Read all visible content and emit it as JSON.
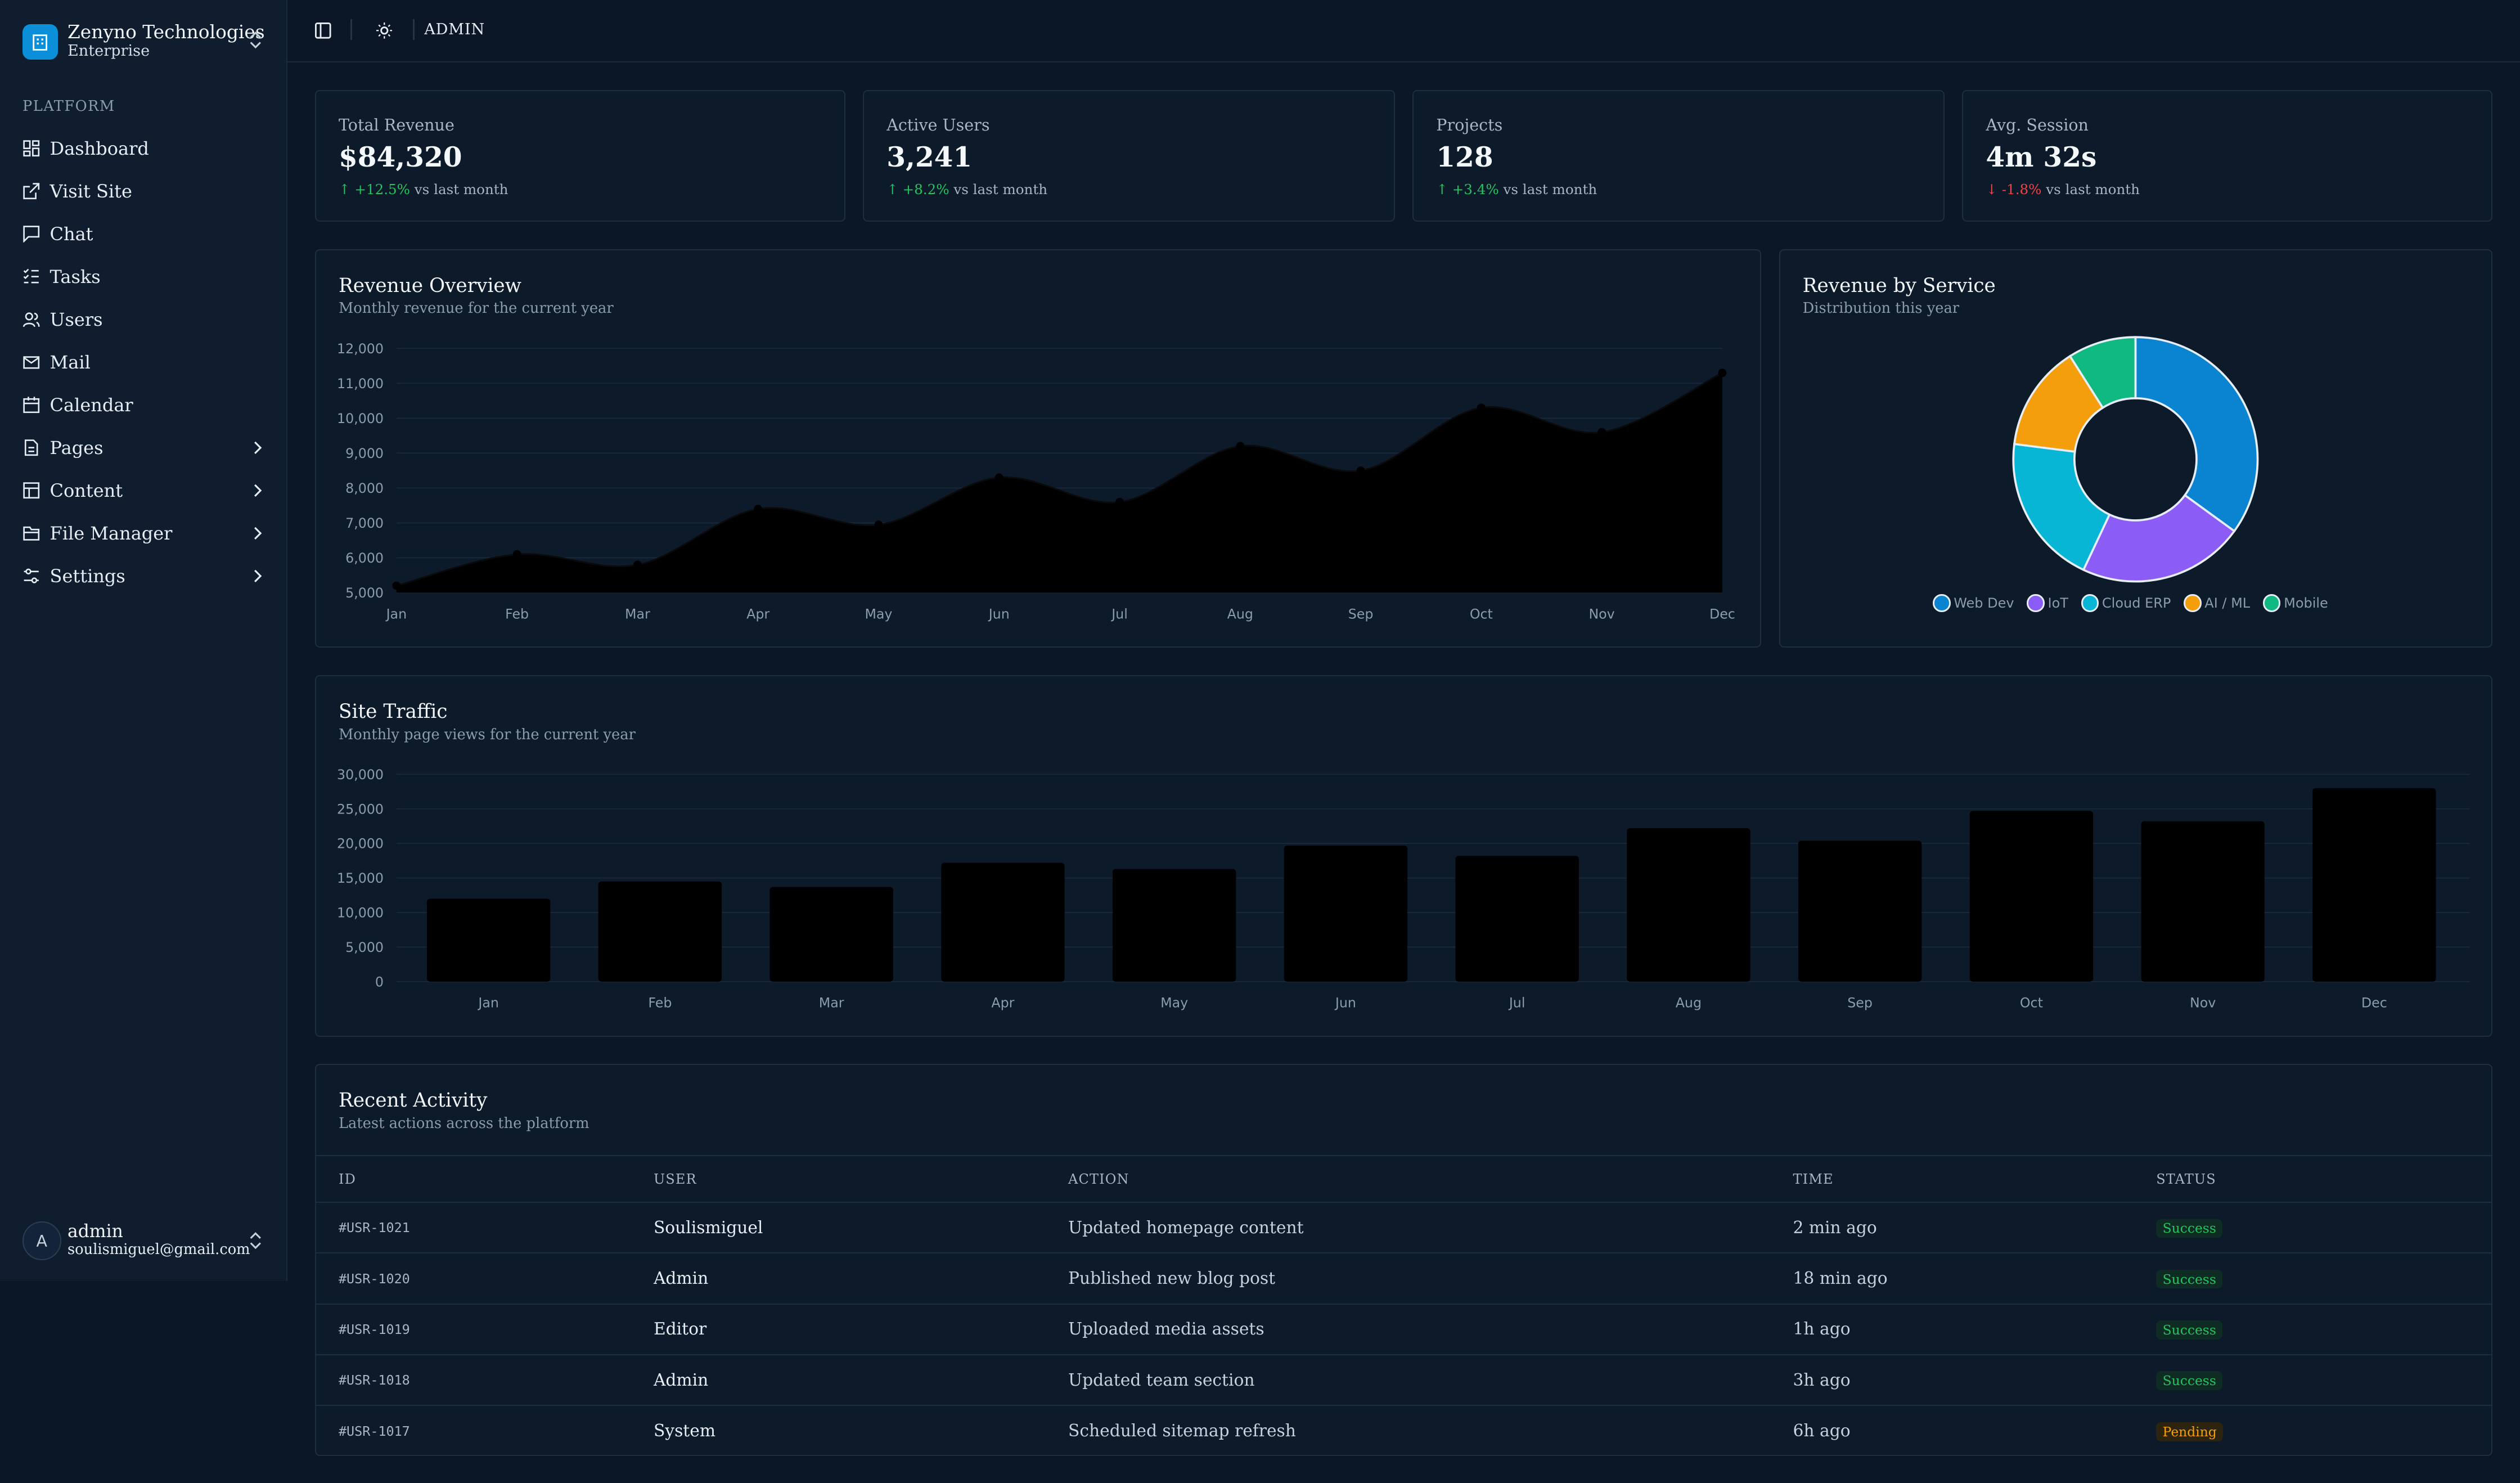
{
  "brand": {
    "name": "Zenyno Technologies",
    "plan": "Enterprise"
  },
  "sidebar": {
    "section_label": "PLATFORM",
    "items": [
      {
        "label": "Dashboard",
        "icon": "dashboard-icon",
        "has_submenu": false
      },
      {
        "label": "Visit Site",
        "icon": "external-link-icon",
        "has_submenu": false
      },
      {
        "label": "Chat",
        "icon": "chat-icon",
        "has_submenu": false
      },
      {
        "label": "Tasks",
        "icon": "tasks-icon",
        "has_submenu": false
      },
      {
        "label": "Users",
        "icon": "users-icon",
        "has_submenu": false
      },
      {
        "label": "Mail",
        "icon": "mail-icon",
        "has_submenu": false
      },
      {
        "label": "Calendar",
        "icon": "calendar-icon",
        "has_submenu": false
      },
      {
        "label": "Pages",
        "icon": "page-icon",
        "has_submenu": true
      },
      {
        "label": "Content",
        "icon": "layout-icon",
        "has_submenu": true
      },
      {
        "label": "File Manager",
        "icon": "folder-icon",
        "has_submenu": true
      },
      {
        "label": "Settings",
        "icon": "sliders-icon",
        "has_submenu": true
      }
    ],
    "user": {
      "initial": "A",
      "name": "admin",
      "email": "soulismiguel@gmail.com"
    }
  },
  "topbar": {
    "breadcrumb": "ADMIN"
  },
  "stats": [
    {
      "label": "Total Revenue",
      "value": "$84,320",
      "change": "+12.5%",
      "direction": "up",
      "suffix": "vs last month"
    },
    {
      "label": "Active Users",
      "value": "3,241",
      "change": "+8.2%",
      "direction": "up",
      "suffix": "vs last month"
    },
    {
      "label": "Projects",
      "value": "128",
      "change": "+3.4%",
      "direction": "up",
      "suffix": "vs last month"
    },
    {
      "label": "Avg. Session",
      "value": "4m 32s",
      "change": "-1.8%",
      "direction": "down",
      "suffix": "vs last month"
    }
  ],
  "revenue_card": {
    "title": "Revenue Overview",
    "subtitle": "Monthly revenue for the current year"
  },
  "service_card": {
    "title": "Revenue by Service",
    "subtitle": "Distribution this year"
  },
  "traffic_card": {
    "title": "Site Traffic",
    "subtitle": "Monthly page views for the current year"
  },
  "activity": {
    "title": "Recent Activity",
    "subtitle": "Latest actions across the platform",
    "columns": [
      "ID",
      "USER",
      "ACTION",
      "TIME",
      "STATUS"
    ],
    "rows": [
      {
        "id": "#USR-1021",
        "user": "Soulismiguel",
        "action": "Updated homepage content",
        "time": "2 min ago",
        "status": "Success"
      },
      {
        "id": "#USR-1020",
        "user": "Admin",
        "action": "Published new blog post",
        "time": "18 min ago",
        "status": "Success"
      },
      {
        "id": "#USR-1019",
        "user": "Editor",
        "action": "Uploaded media assets",
        "time": "1h ago",
        "status": "Success"
      },
      {
        "id": "#USR-1018",
        "user": "Admin",
        "action": "Updated team section",
        "time": "3h ago",
        "status": "Success"
      },
      {
        "id": "#USR-1017",
        "user": "System",
        "action": "Scheduled sitemap refresh",
        "time": "6h ago",
        "status": "Pending"
      }
    ]
  },
  "colors": {
    "accent": "#0a8fd8",
    "success": "#22c55e",
    "danger": "#ef4444",
    "pending": "#f59e0b"
  },
  "chart_data": [
    {
      "type": "area",
      "categories": [
        "Jan",
        "Feb",
        "Mar",
        "Apr",
        "May",
        "Jun",
        "Jul",
        "Aug",
        "Sep",
        "Oct",
        "Nov",
        "Dec"
      ],
      "values": [
        5200,
        6100,
        5800,
        7400,
        6950,
        8300,
        7600,
        9200,
        8500,
        10300,
        9600,
        11300
      ],
      "yticks": [
        5000,
        6000,
        7000,
        8000,
        9000,
        10000,
        11000,
        12000
      ],
      "ytick_labels": [
        "5,000",
        "6,000",
        "7,000",
        "8,000",
        "9,000",
        "10,000",
        "11,000",
        "12,000"
      ],
      "ylim": [
        5000,
        12000
      ],
      "grid": true
    },
    {
      "type": "pie",
      "labels": [
        "Web Dev",
        "IoT",
        "Cloud ERP",
        "AI / ML",
        "Mobile"
      ],
      "values": [
        35,
        22,
        20,
        14,
        9
      ],
      "colors": [
        "#0a84d0",
        "#8b5cf6",
        "#06b6d4",
        "#f59e0b",
        "#10b981"
      ],
      "legend": "bottom"
    },
    {
      "type": "bar",
      "categories": [
        "Jan",
        "Feb",
        "Mar",
        "Apr",
        "May",
        "Jun",
        "Jul",
        "Aug",
        "Sep",
        "Oct",
        "Nov",
        "Dec"
      ],
      "values": [
        12000,
        14500,
        13700,
        17200,
        16300,
        19700,
        18200,
        22200,
        20400,
        24700,
        23200,
        28000
      ],
      "yticks": [
        0,
        5000,
        10000,
        15000,
        20000,
        25000,
        30000
      ],
      "ytick_labels": [
        "0",
        "5,000",
        "10,000",
        "15,000",
        "20,000",
        "25,000",
        "30,000"
      ],
      "ylim": [
        0,
        30000
      ],
      "grid": true
    }
  ]
}
